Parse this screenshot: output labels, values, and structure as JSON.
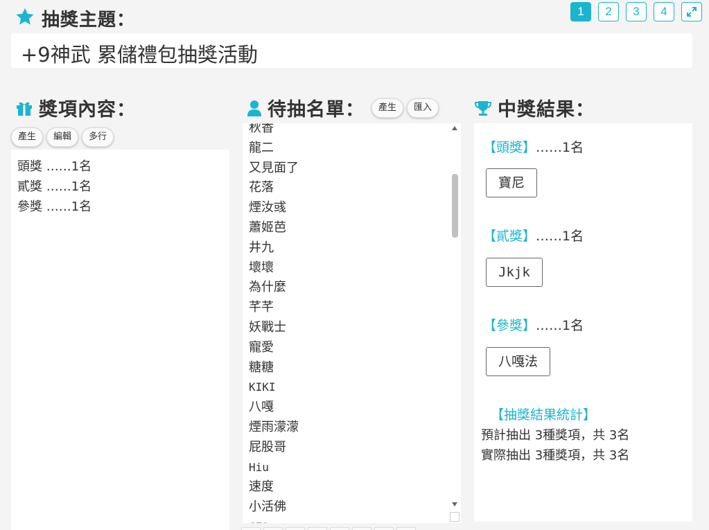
{
  "header": {
    "title": "抽獎主題：",
    "theme": "+9神武 累儲禮包抽獎活動",
    "pages": [
      "1",
      "2",
      "3",
      "4"
    ],
    "active_page": "1"
  },
  "prizes": {
    "title": "獎項內容：",
    "buttons": [
      "產生",
      "編輯",
      "多行"
    ],
    "items": [
      "頭獎 ……1名",
      "貳獎 ……1名",
      "參獎 ……1名"
    ]
  },
  "candidates": {
    "title": "待抽名單：",
    "buttons": [
      "產生",
      "匯入"
    ],
    "items": [
      "秋香",
      "龍二",
      "又見面了",
      "花落",
      "煙汝彧",
      "蕭姬芭",
      "井九",
      "壞壞",
      "為什麼",
      "芊芊",
      "妖戰士",
      "寵愛",
      "糖糖",
      "KIKI",
      "八嘎",
      "煙雨濛濛",
      "屁股哥",
      "Hiu",
      "速度",
      "小活佛",
      "CEO"
    ]
  },
  "results": {
    "title": "中獎結果：",
    "groups": [
      {
        "bracket": "【頭獎】",
        "count": "……1名",
        "winner": "寶尼"
      },
      {
        "bracket": "【貳獎】",
        "count": "……1名",
        "winner": "Jkjk"
      },
      {
        "bracket": "【參獎】",
        "count": "……1名",
        "winner": "八嘎法"
      }
    ],
    "stat_title": "【抽獎結果統計】",
    "stat_lines": [
      "預計抽出 3種獎項，共 3名",
      "實際抽出 3種獎項，共 3名"
    ]
  },
  "colors": {
    "accent": "#1ab5cf",
    "background": "#f4f4f4"
  }
}
